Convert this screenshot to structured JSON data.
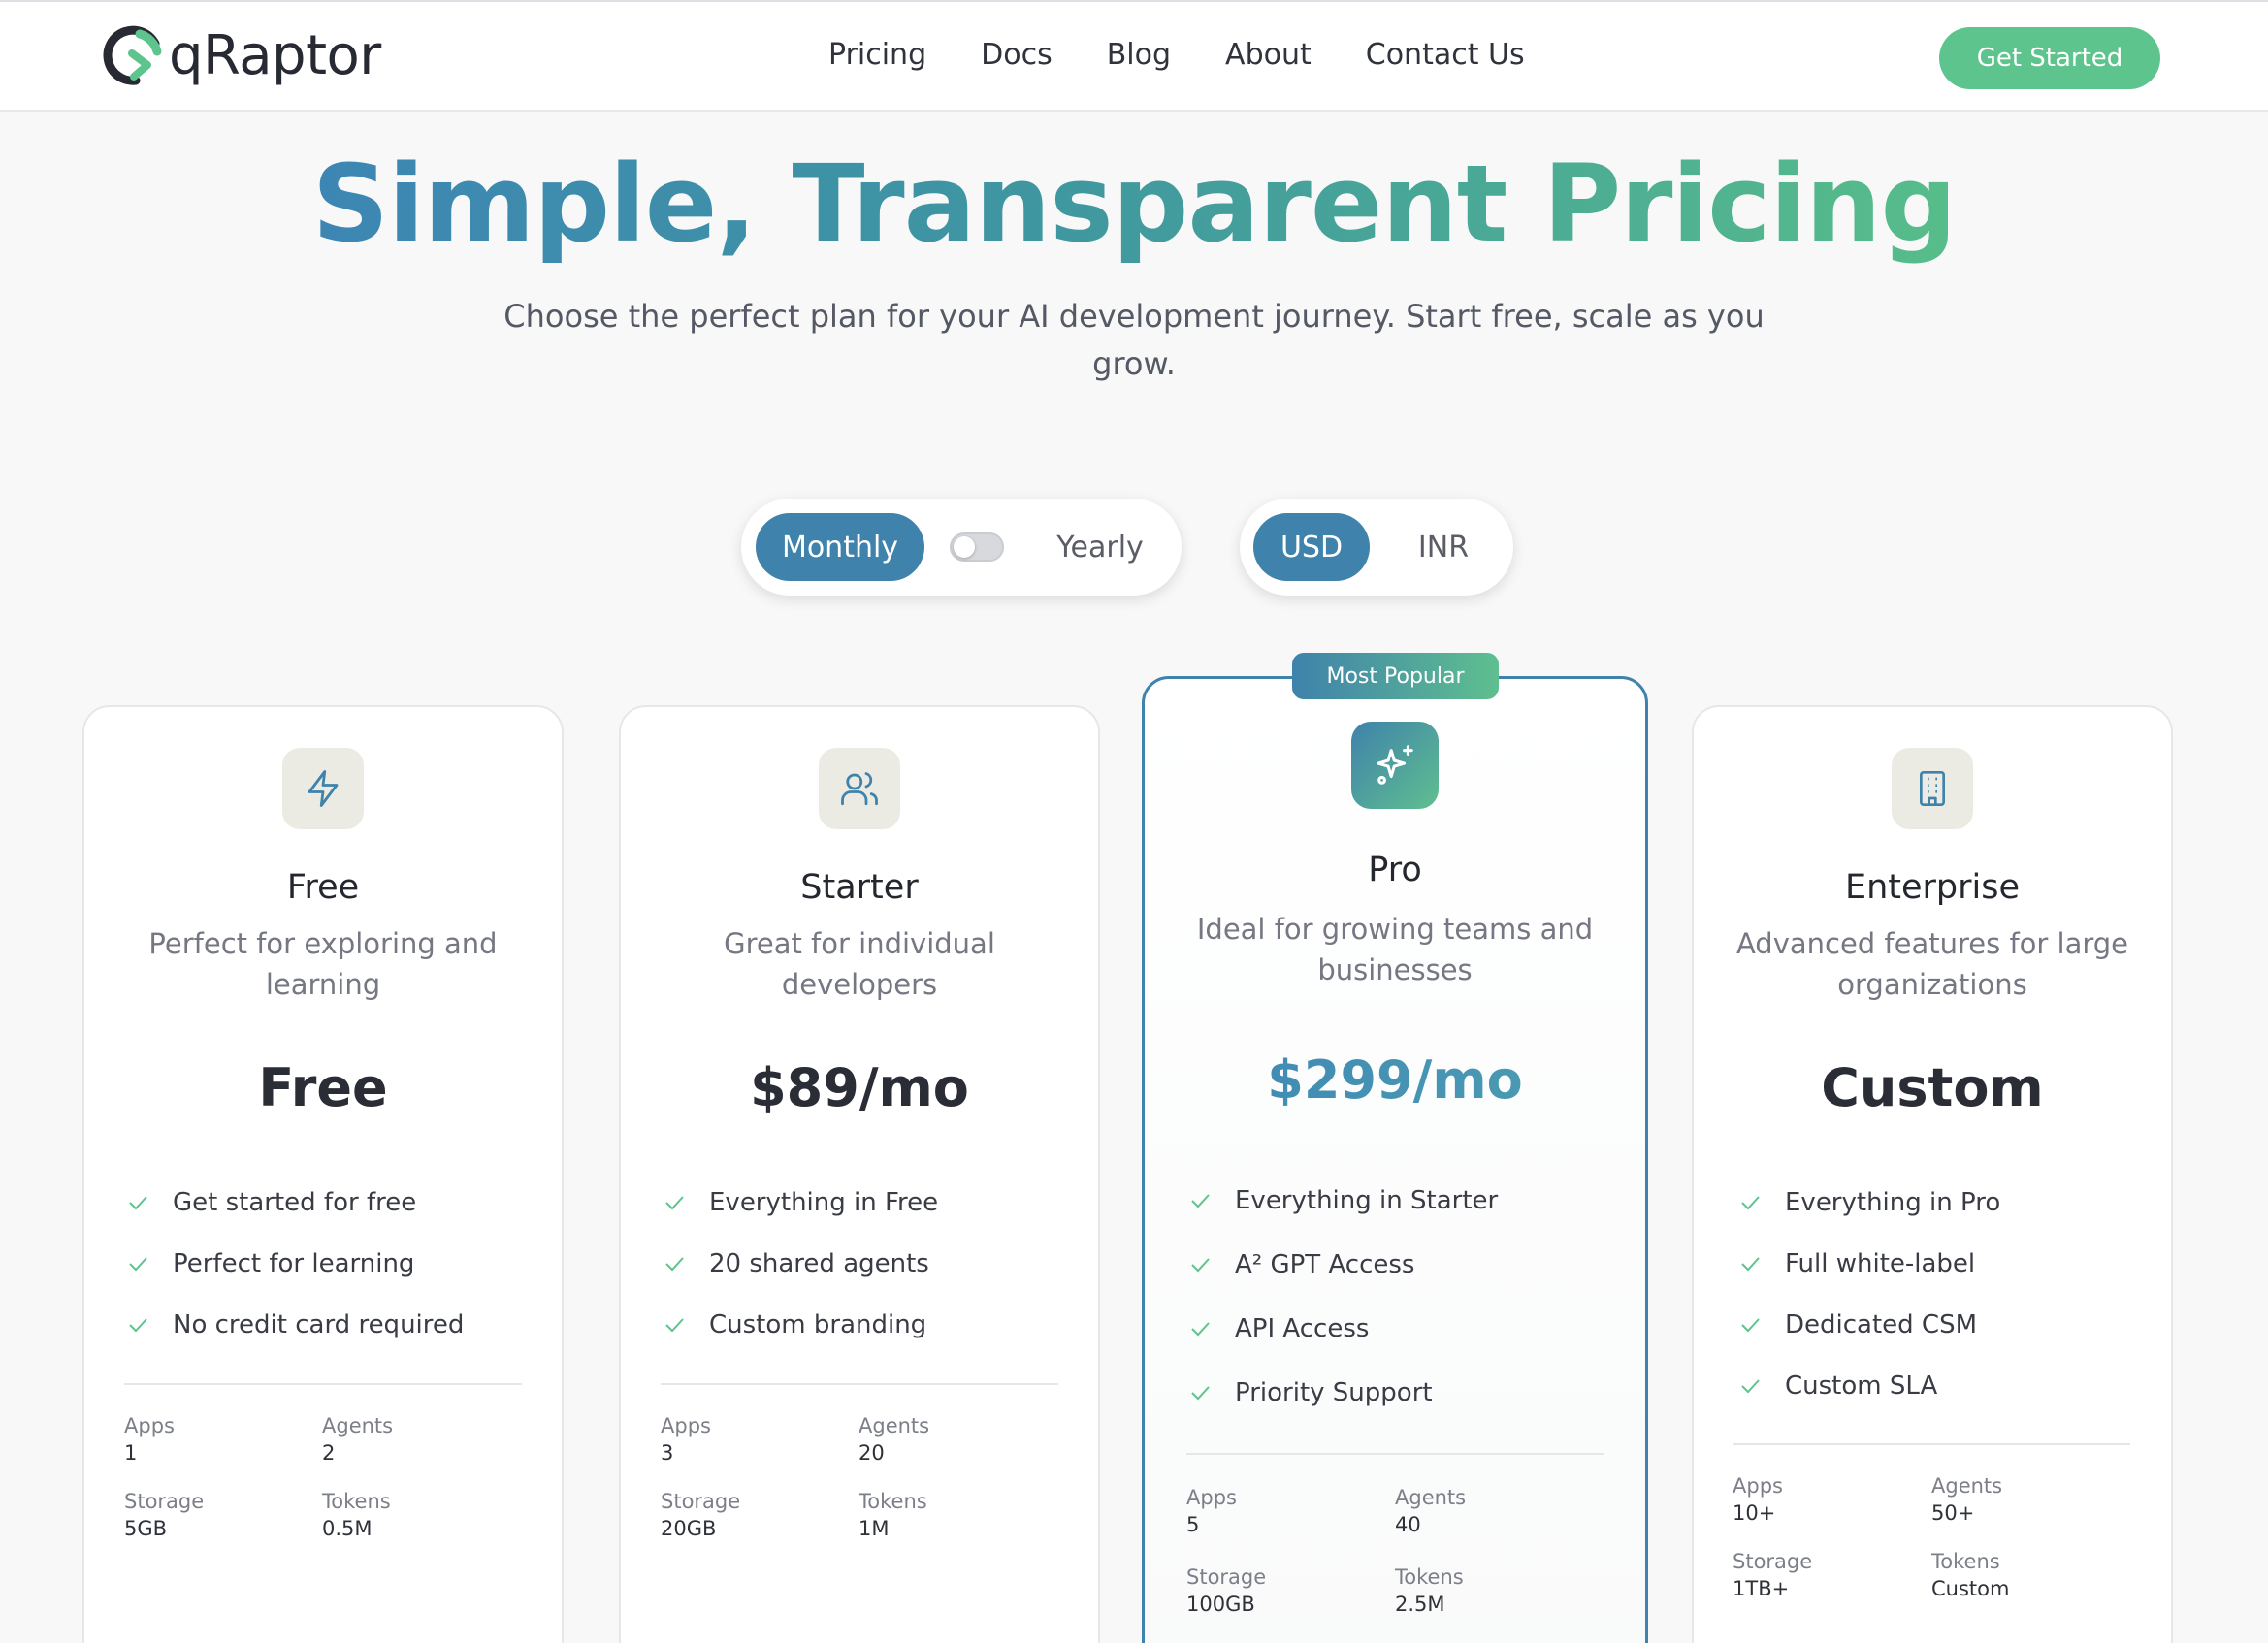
{
  "header": {
    "logo_text": "qRaptor",
    "nav": [
      "Pricing",
      "Docs",
      "Blog",
      "About",
      "Contact Us"
    ],
    "cta": "Get Started"
  },
  "hero": {
    "title": "Simple, Transparent Pricing",
    "subtitle": "Choose the perfect plan for your AI development journey. Start free, scale as you grow."
  },
  "billing": {
    "monthly": "Monthly",
    "yearly": "Yearly",
    "selected": "Monthly"
  },
  "currency": {
    "usd": "USD",
    "inr": "INR",
    "selected": "USD"
  },
  "colors": {
    "brand_blue": "#3f82ab",
    "brand_green": "#5ec48e",
    "check": "#5ec48e"
  },
  "stat_labels": {
    "apps": "Apps",
    "agents": "Agents",
    "storage": "Storage",
    "tokens": "Tokens"
  },
  "plans": [
    {
      "icon": "lightning-icon",
      "name": "Free",
      "description": "Perfect for exploring and learning",
      "price": "Free",
      "features": [
        "Get started for free",
        "Perfect for learning",
        "No credit card required"
      ],
      "stats": {
        "apps": "1",
        "agents": "2",
        "storage": "5GB",
        "tokens": "0.5M"
      }
    },
    {
      "icon": "users-icon",
      "name": "Starter",
      "description": "Great for individual developers",
      "price": "$89/mo",
      "features": [
        "Everything in Free",
        "20 shared agents",
        "Custom branding"
      ],
      "stats": {
        "apps": "3",
        "agents": "20",
        "storage": "20GB",
        "tokens": "1M"
      }
    },
    {
      "icon": "sparkles-icon",
      "badge": "Most Popular",
      "name": "Pro",
      "description": "Ideal for growing teams and businesses",
      "price": "$299/mo",
      "features": [
        "Everything in Starter",
        "A² GPT Access",
        "API Access",
        "Priority Support"
      ],
      "stats": {
        "apps": "5",
        "agents": "40",
        "storage": "100GB",
        "tokens": "2.5M"
      }
    },
    {
      "icon": "building-icon",
      "name": "Enterprise",
      "description": "Advanced features for large organizations",
      "price": "Custom",
      "features": [
        "Everything in Pro",
        "Full white-label",
        "Dedicated CSM",
        "Custom SLA"
      ],
      "stats": {
        "apps": "10+",
        "agents": "50+",
        "storage": "1TB+",
        "tokens": "Custom"
      }
    }
  ]
}
